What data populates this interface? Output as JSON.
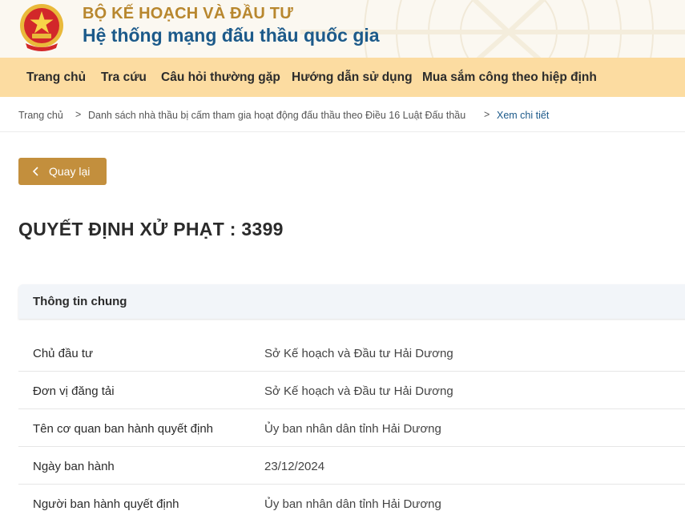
{
  "header": {
    "org_name": "BỘ KẾ HOẠCH VÀ ĐẦU TƯ",
    "system_name": "Hệ thống mạng đấu thầu quốc gia",
    "emblem_icon": "national-emblem-icon"
  },
  "nav": {
    "items": [
      {
        "label": "Trang chủ"
      },
      {
        "label": "Tra cứu"
      },
      {
        "label": "Câu hỏi thường gặp"
      },
      {
        "label": "Hướng dẫn sử dụng"
      },
      {
        "label": "Mua sắm công theo hiệp định"
      }
    ]
  },
  "breadcrumb": {
    "items": [
      {
        "label": "Trang chủ"
      },
      {
        "label": "Danh sách nhà thầu bị cấm tham gia hoạt động đấu thầu theo Điều 16 Luật Đấu thầu"
      },
      {
        "label": "Xem chi tiết"
      }
    ],
    "separator": ">"
  },
  "back_button": {
    "label": "Quay lại"
  },
  "page_title": "QUYẾT ĐỊNH XỬ PHẠT : 3399",
  "section": {
    "title": "Thông tin chung",
    "rows": [
      {
        "key": "Chủ đầu tư",
        "value": "Sở Kế hoạch và Đầu tư Hải Dương"
      },
      {
        "key": "Đơn vị đăng tải",
        "value": "Sở Kế hoạch và Đầu tư Hải Dương"
      },
      {
        "key": "Tên cơ quan ban hành quyết định",
        "value": "Ủy ban nhân dân tỉnh Hải Dương"
      },
      {
        "key": "Ngày ban hành",
        "value": "23/12/2024"
      },
      {
        "key": "Người ban hành quyết định",
        "value": "Ủy ban nhân dân tỉnh Hải Dương"
      }
    ]
  },
  "colors": {
    "org_gold": "#b8872e",
    "system_blue": "#1c5a8a",
    "nav_bg": "#fcdca1",
    "button_bg": "#c38f3d",
    "section_bg": "#f2f5f9"
  }
}
